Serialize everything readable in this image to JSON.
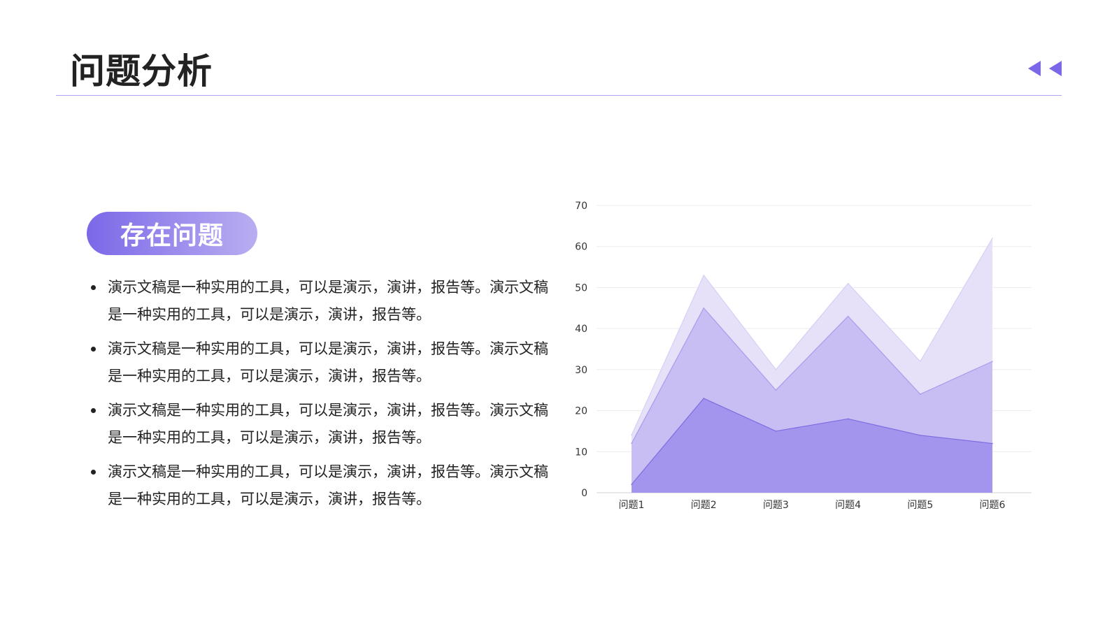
{
  "page": {
    "title": "问题分析",
    "accent_color": "#7B68E8",
    "nav_icon": "double-left-triangle-icon"
  },
  "section": {
    "badge_label": "存在问题"
  },
  "bullets": [
    "演示文稿是一种实用的工具，可以是演示，演讲，报告等。演示文稿是一种实用的工具，可以是演示，演讲，报告等。",
    "演示文稿是一种实用的工具，可以是演示，演讲，报告等。演示文稿是一种实用的工具，可以是演示，演讲，报告等。",
    "演示文稿是一种实用的工具，可以是演示，演讲，报告等。演示文稿是一种实用的工具，可以是演示，演讲，报告等。",
    "演示文稿是一种实用的工具，可以是演示，演讲，报告等。演示文稿是一种实用的工具，可以是演示，演讲，报告等。"
  ],
  "chart_data": {
    "type": "area",
    "categories": [
      "问题1",
      "问题2",
      "问题3",
      "问题4",
      "问题5",
      "问题6"
    ],
    "ylim": [
      0,
      70
    ],
    "yticks": [
      0,
      10,
      20,
      30,
      40,
      50,
      60,
      70
    ],
    "grid": true,
    "legend": "none",
    "series": [
      {
        "values": [
          14,
          53,
          30,
          51,
          32,
          62
        ],
        "color": "#E6E1F9",
        "stroke": "#D6CFF5"
      },
      {
        "values": [
          12,
          45,
          25,
          43,
          24,
          32
        ],
        "color": "#C8BEF4",
        "stroke": "#A99CEC"
      },
      {
        "values": [
          2,
          23,
          15,
          18,
          14,
          12
        ],
        "color": "#A395EE",
        "stroke": "#7E6CE0"
      }
    ]
  }
}
